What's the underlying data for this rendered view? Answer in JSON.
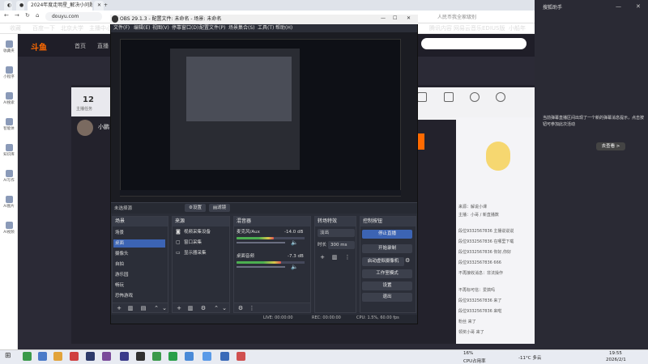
{
  "browser": {
    "tabs": [
      "2024年度走明星_解决小问题",
      "斗鱼"
    ],
    "new_tab": "+",
    "url": "douyu.com",
    "search_hint": "人民币我全家级别",
    "bookmarks": [
      "收藏",
      "百度一下",
      "北京大学",
      "主播中心",
      "新闻",
      "AI 搜索",
      "播放",
      "腾讯内容",
      "网易云音乐",
      "EDIUS版",
      "小船年",
      "直播",
      "消息"
    ]
  },
  "left_sidebar": {
    "items": [
      "收藏夹",
      "小程序",
      "AI搜索",
      "智能体",
      "知识库",
      "AI写作",
      "AI图片",
      "AI视频"
    ]
  },
  "douyu": {
    "logo": "斗鱼",
    "nav": [
      "首页",
      "直播"
    ],
    "count": "12",
    "count_label": "主播任务",
    "user_label": "小鹏",
    "chat_header": "来源：解说小课",
    "chat_sub": "主播：小哥 / 新直播数",
    "chat_lines": [
      "段位9332567836 主播说说说",
      "段位9332567836 在哪里下载",
      "段位9332567836 你好,你好",
      "段位9332567836 666",
      "不再接收消息：非法操作",
      "不再标可信：爱搞吗",
      "段位9332567836 来了",
      "段位9332567836 来啦",
      "粉丝 来了",
      "领奖小哥 来了"
    ]
  },
  "right_overlay": {
    "title": "搜狐助手",
    "tip": "当前弹幕直播区间出现了一个新的弹幕消息提示，点击按钮可参加此次活动",
    "cta": "去查看 >",
    "timestamp": "19:55"
  },
  "obs": {
    "title": "OBS 29.1.3 - 配置文件: 未命名 - 场景: 未命名",
    "menu": [
      "文件(F)",
      "编辑(E)",
      "视图(V)",
      "停靠窗口(D)",
      "配置文件(P)",
      "场景集合(S)",
      "工具(T)",
      "帮助(H)"
    ],
    "source_bar_label": "未选择源",
    "properties_button": "设置",
    "filters_button": "滤镜",
    "docks": {
      "scenes": {
        "title": "场景",
        "items": [
          "场景",
          "桌面",
          "摄像头",
          "自拍",
          "游乐园",
          "畅玩",
          "恐怖游戏"
        ]
      },
      "sources": {
        "title": "来源",
        "items": [
          "视频采集设备",
          "窗口采集"
        ],
        "extra": "显示器采集"
      },
      "mixer": {
        "title": "混音器",
        "channels": [
          {
            "name": "麦克风/Aux",
            "db": "-14.0 dB",
            "level": 0.55
          },
          {
            "name": "桌面音频",
            "db": "-7.3 dB",
            "level": 0.65
          }
        ]
      },
      "transitions": {
        "title": "转场特效",
        "type": "淡出",
        "duration_label": "时长",
        "duration": "300 ms"
      },
      "controls": {
        "title": "控制按钮",
        "buttons": [
          "停止直播",
          "开始录制",
          "启动虚拟摄像机",
          "工作室模式",
          "设置",
          "退出"
        ]
      }
    },
    "status": {
      "live": "LIVE: 00:00:00",
      "rec": "REC: 00:00:00",
      "cpu": "CPU: 1.5%, 60.00 fps"
    }
  },
  "taskbar": {
    "weather": "-11°C 多云",
    "time": "19:55",
    "date": "2026/2/1",
    "cpu": "16%",
    "cpu_label": "CPU占用率"
  },
  "colors": {
    "accent": "#3c64b4",
    "douyu": "#ff6a00"
  }
}
